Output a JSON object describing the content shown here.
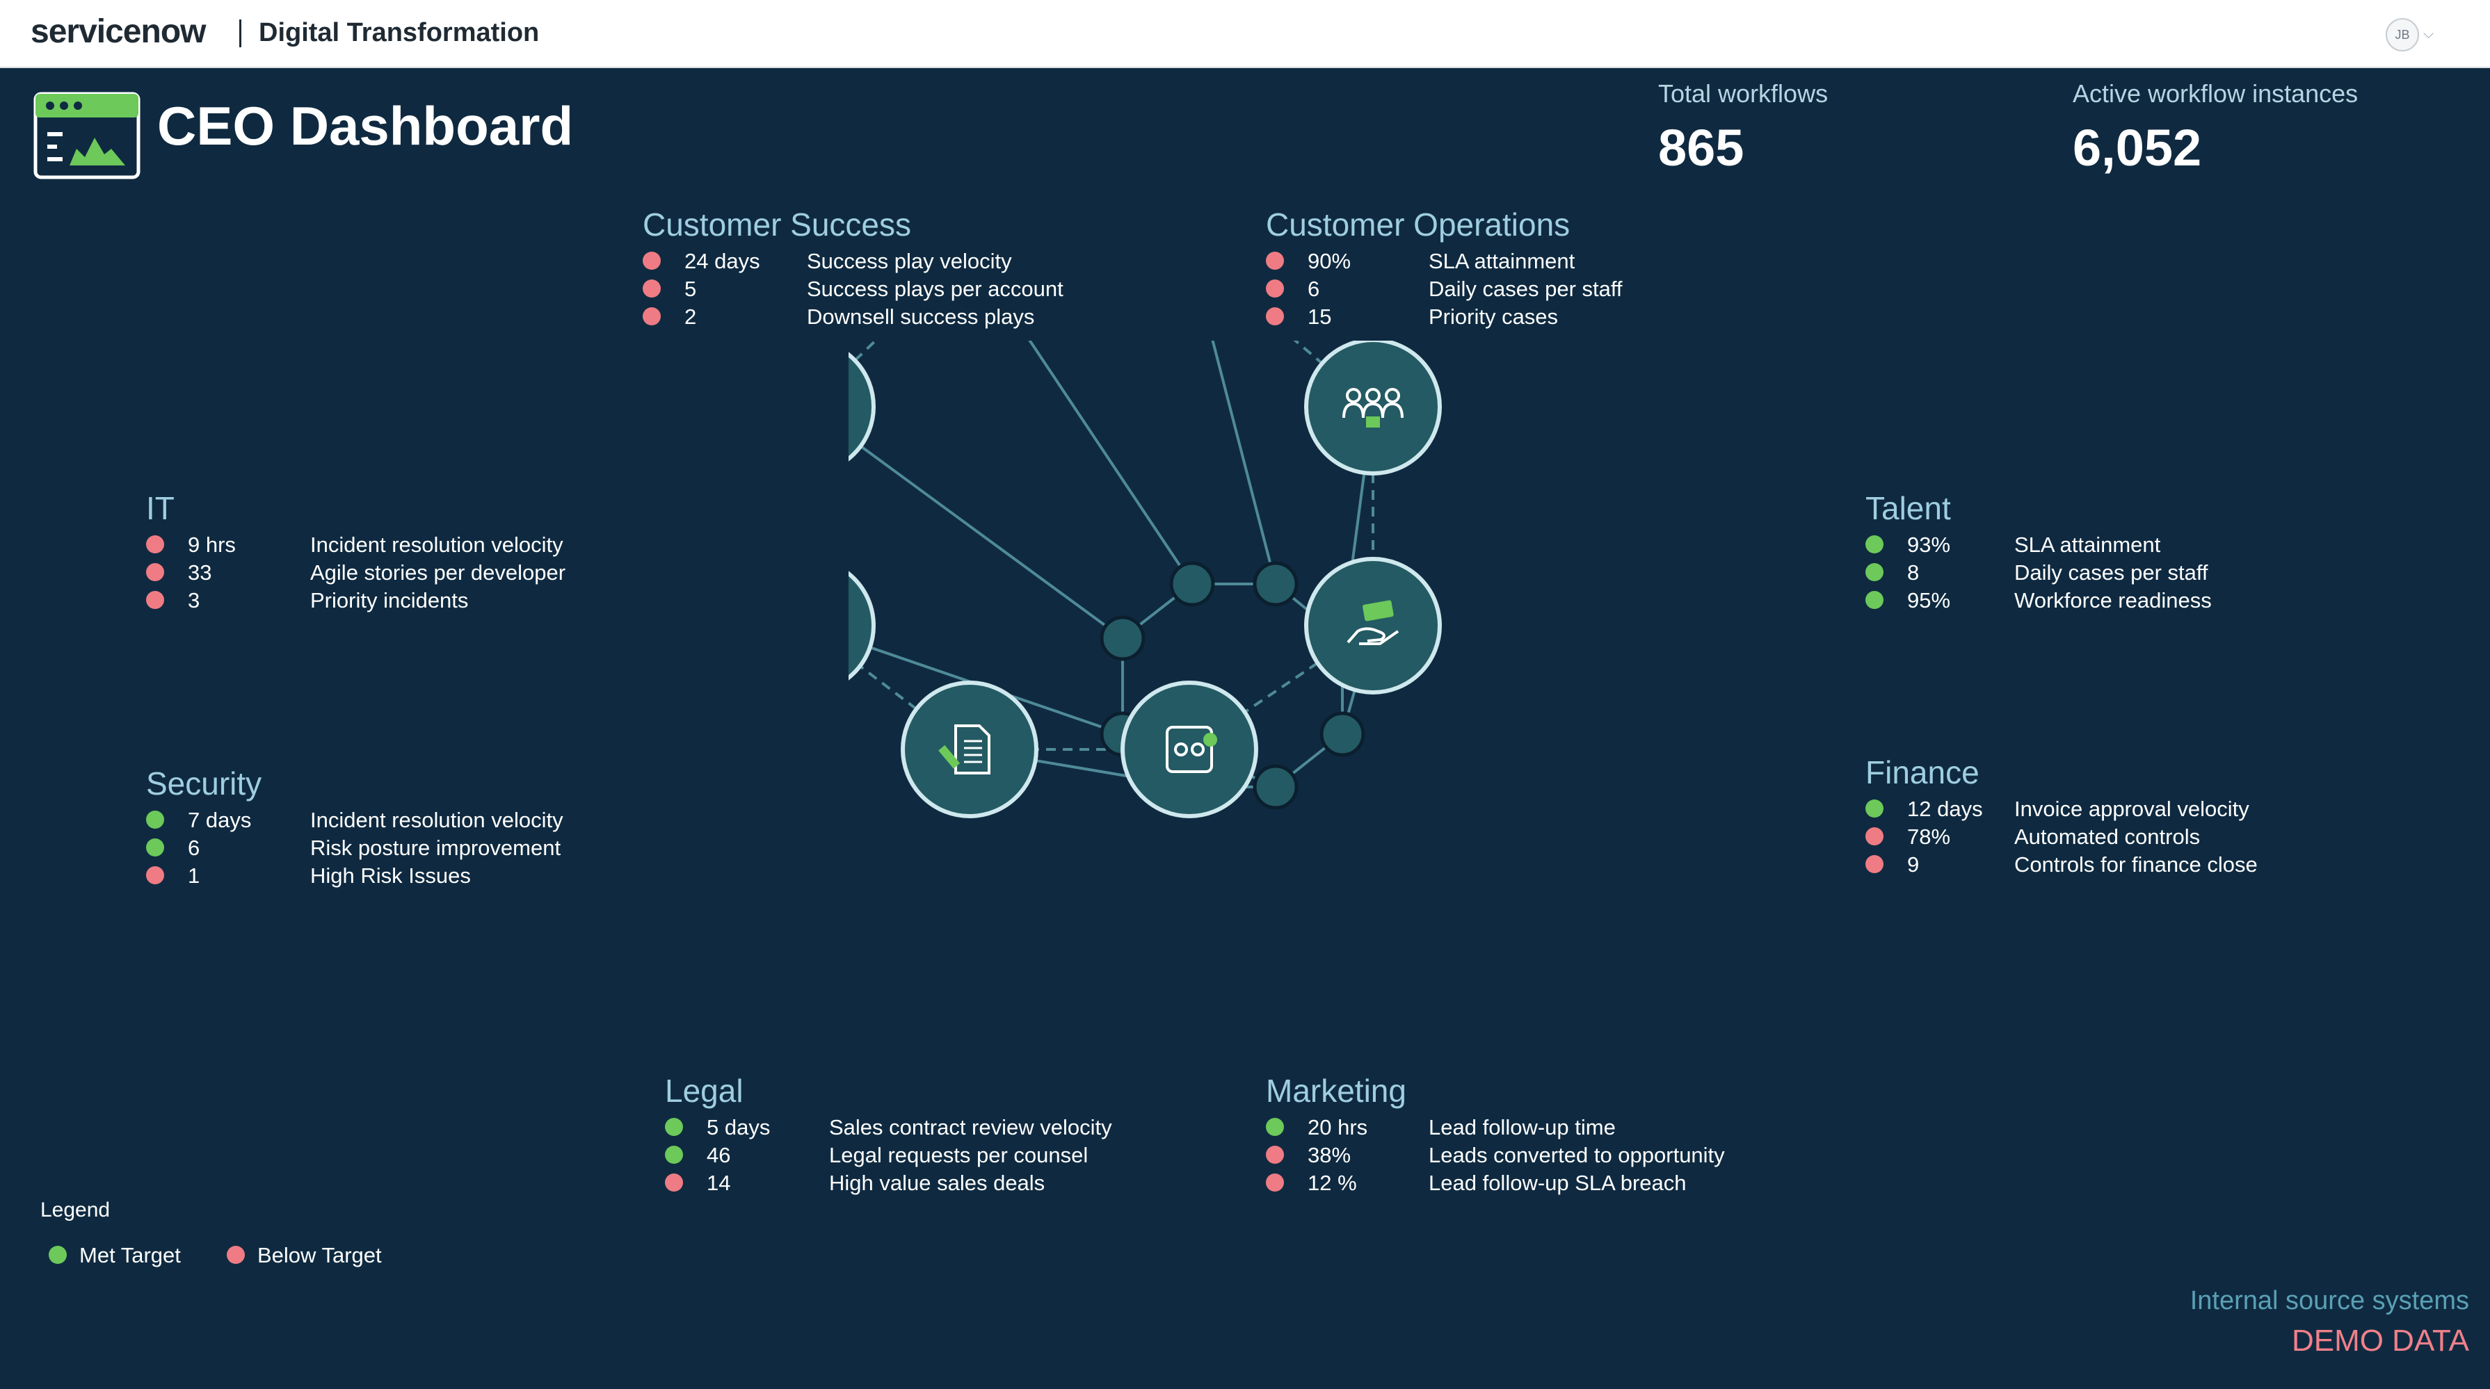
{
  "header": {
    "brand": "servicenow",
    "subtitle": "Digital Transformation",
    "user_initials": "JB"
  },
  "page": {
    "title": "CEO Dashboard"
  },
  "kpis": [
    {
      "label": "Total workflows",
      "value": "865"
    },
    {
      "label": "Active workflow instances",
      "value": "6,052"
    }
  ],
  "colors": {
    "met": "#6cc95a",
    "below": "#ef7c84",
    "node_fill": "#245a63",
    "node_stroke": "#cfe8ee",
    "line": "#4f8a98",
    "background": "#0f2a40"
  },
  "sections": {
    "customer_success": {
      "title": "Customer Success",
      "metrics": [
        {
          "value": "24 days",
          "label": "Success play velocity",
          "status": "below"
        },
        {
          "value": "5",
          "label": "Success plays per account",
          "status": "below"
        },
        {
          "value": "2",
          "label": "Downsell success plays",
          "status": "below"
        }
      ]
    },
    "customer_operations": {
      "title": "Customer Operations",
      "metrics": [
        {
          "value": "90%",
          "label": "SLA attainment",
          "status": "below"
        },
        {
          "value": "6",
          "label": "Daily cases per staff",
          "status": "below"
        },
        {
          "value": "15",
          "label": "Priority cases",
          "status": "below"
        }
      ]
    },
    "it": {
      "title": "IT",
      "metrics": [
        {
          "value": "9 hrs",
          "label": "Incident resolution velocity",
          "status": "below"
        },
        {
          "value": "33",
          "label": "Agile stories per developer",
          "status": "below"
        },
        {
          "value": "3",
          "label": "Priority incidents",
          "status": "below"
        }
      ]
    },
    "security": {
      "title": "Security",
      "metrics": [
        {
          "value": "7 days",
          "label": "Incident resolution velocity",
          "status": "met"
        },
        {
          "value": "6",
          "label": "Risk posture improvement",
          "status": "met"
        },
        {
          "value": "1",
          "label": "High Risk Issues",
          "status": "below"
        }
      ]
    },
    "talent": {
      "title": "Talent",
      "metrics": [
        {
          "value": "93%",
          "label": "SLA attainment",
          "status": "met"
        },
        {
          "value": "8",
          "label": "Daily cases per staff",
          "status": "met"
        },
        {
          "value": "95%",
          "label": "Workforce readiness",
          "status": "met"
        }
      ]
    },
    "finance": {
      "title": "Finance",
      "metrics": [
        {
          "value": "12 days",
          "label": "Invoice approval velocity",
          "status": "met"
        },
        {
          "value": "78%",
          "label": "Automated controls",
          "status": "below"
        },
        {
          "value": "9",
          "label": "Controls for finance close",
          "status": "below"
        }
      ]
    },
    "legal": {
      "title": "Legal",
      "metrics": [
        {
          "value": "5 days",
          "label": "Sales contract review velocity",
          "status": "met"
        },
        {
          "value": "46",
          "label": "Legal requests per counsel",
          "status": "met"
        },
        {
          "value": "14",
          "label": "High value sales deals",
          "status": "below"
        }
      ]
    },
    "marketing": {
      "title": "Marketing",
      "metrics": [
        {
          "value": "20 hrs",
          "label": "Lead follow-up time",
          "status": "met"
        },
        {
          "value": "38%",
          "label": "Leads converted to opportunity",
          "status": "below"
        },
        {
          "value": "12 %",
          "label": "Lead follow-up SLA breach",
          "status": "below"
        }
      ]
    }
  },
  "network_icons": [
    "chart-up-icon",
    "chart-up-icon",
    "people-group-icon",
    "money-hand-icon",
    "workflow-icon",
    "document-sign-icon",
    "lock-icon",
    "monitor-icon"
  ],
  "legend": {
    "title": "Legend",
    "met_label": "Met Target",
    "below_label": "Below Target"
  },
  "footer": {
    "source": "Internal source systems",
    "demo": "DEMO DATA"
  }
}
